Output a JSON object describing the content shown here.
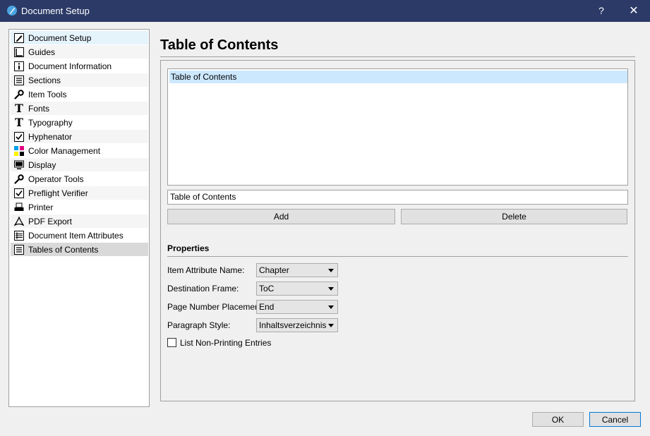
{
  "window": {
    "title": "Document Setup",
    "help_label": "?",
    "close_label": "✕"
  },
  "sidebar": {
    "items": [
      {
        "label": "Document Setup",
        "icon": "document-setup-icon"
      },
      {
        "label": "Guides",
        "icon": "guides-icon"
      },
      {
        "label": "Document Information",
        "icon": "info-icon"
      },
      {
        "label": "Sections",
        "icon": "sections-icon"
      },
      {
        "label": "Item Tools",
        "icon": "wrench-icon"
      },
      {
        "label": "Fonts",
        "icon": "font-icon"
      },
      {
        "label": "Typography",
        "icon": "typography-icon"
      },
      {
        "label": "Hyphenator",
        "icon": "checkbox-icon"
      },
      {
        "label": "Color Management",
        "icon": "color-management-icon"
      },
      {
        "label": "Display",
        "icon": "monitor-icon"
      },
      {
        "label": "Operator Tools",
        "icon": "wrench-icon"
      },
      {
        "label": "Preflight Verifier",
        "icon": "checkbox-icon"
      },
      {
        "label": "Printer",
        "icon": "printer-icon"
      },
      {
        "label": "PDF Export",
        "icon": "pdf-icon"
      },
      {
        "label": "Document Item Attributes",
        "icon": "attributes-icon"
      },
      {
        "label": "Tables of Contents",
        "icon": "toc-icon"
      }
    ],
    "selected": "Tables of Contents"
  },
  "main": {
    "title": "Table of Contents",
    "toc_list": [
      "Table of Contents"
    ],
    "name_value": "Table of Contents",
    "add_label": "Add",
    "delete_label": "Delete",
    "properties": {
      "title": "Properties",
      "item_attribute_name": {
        "label": "Item Attribute Name:",
        "value": "Chapter"
      },
      "destination_frame": {
        "label": "Destination Frame:",
        "value": "ToC"
      },
      "page_number_placement": {
        "label": "Page Number Placement:",
        "value": "End"
      },
      "paragraph_style": {
        "label": "Paragraph Style:",
        "value": "Inhaltsverzeichnis"
      },
      "list_non_printing": {
        "label": "List Non-Printing Entries",
        "checked": false
      }
    }
  },
  "footer": {
    "ok_label": "OK",
    "cancel_label": "Cancel"
  },
  "colors": {
    "titlebar": "#2b3a67",
    "selection": "#cce8ff",
    "accent": "#0078d7"
  }
}
